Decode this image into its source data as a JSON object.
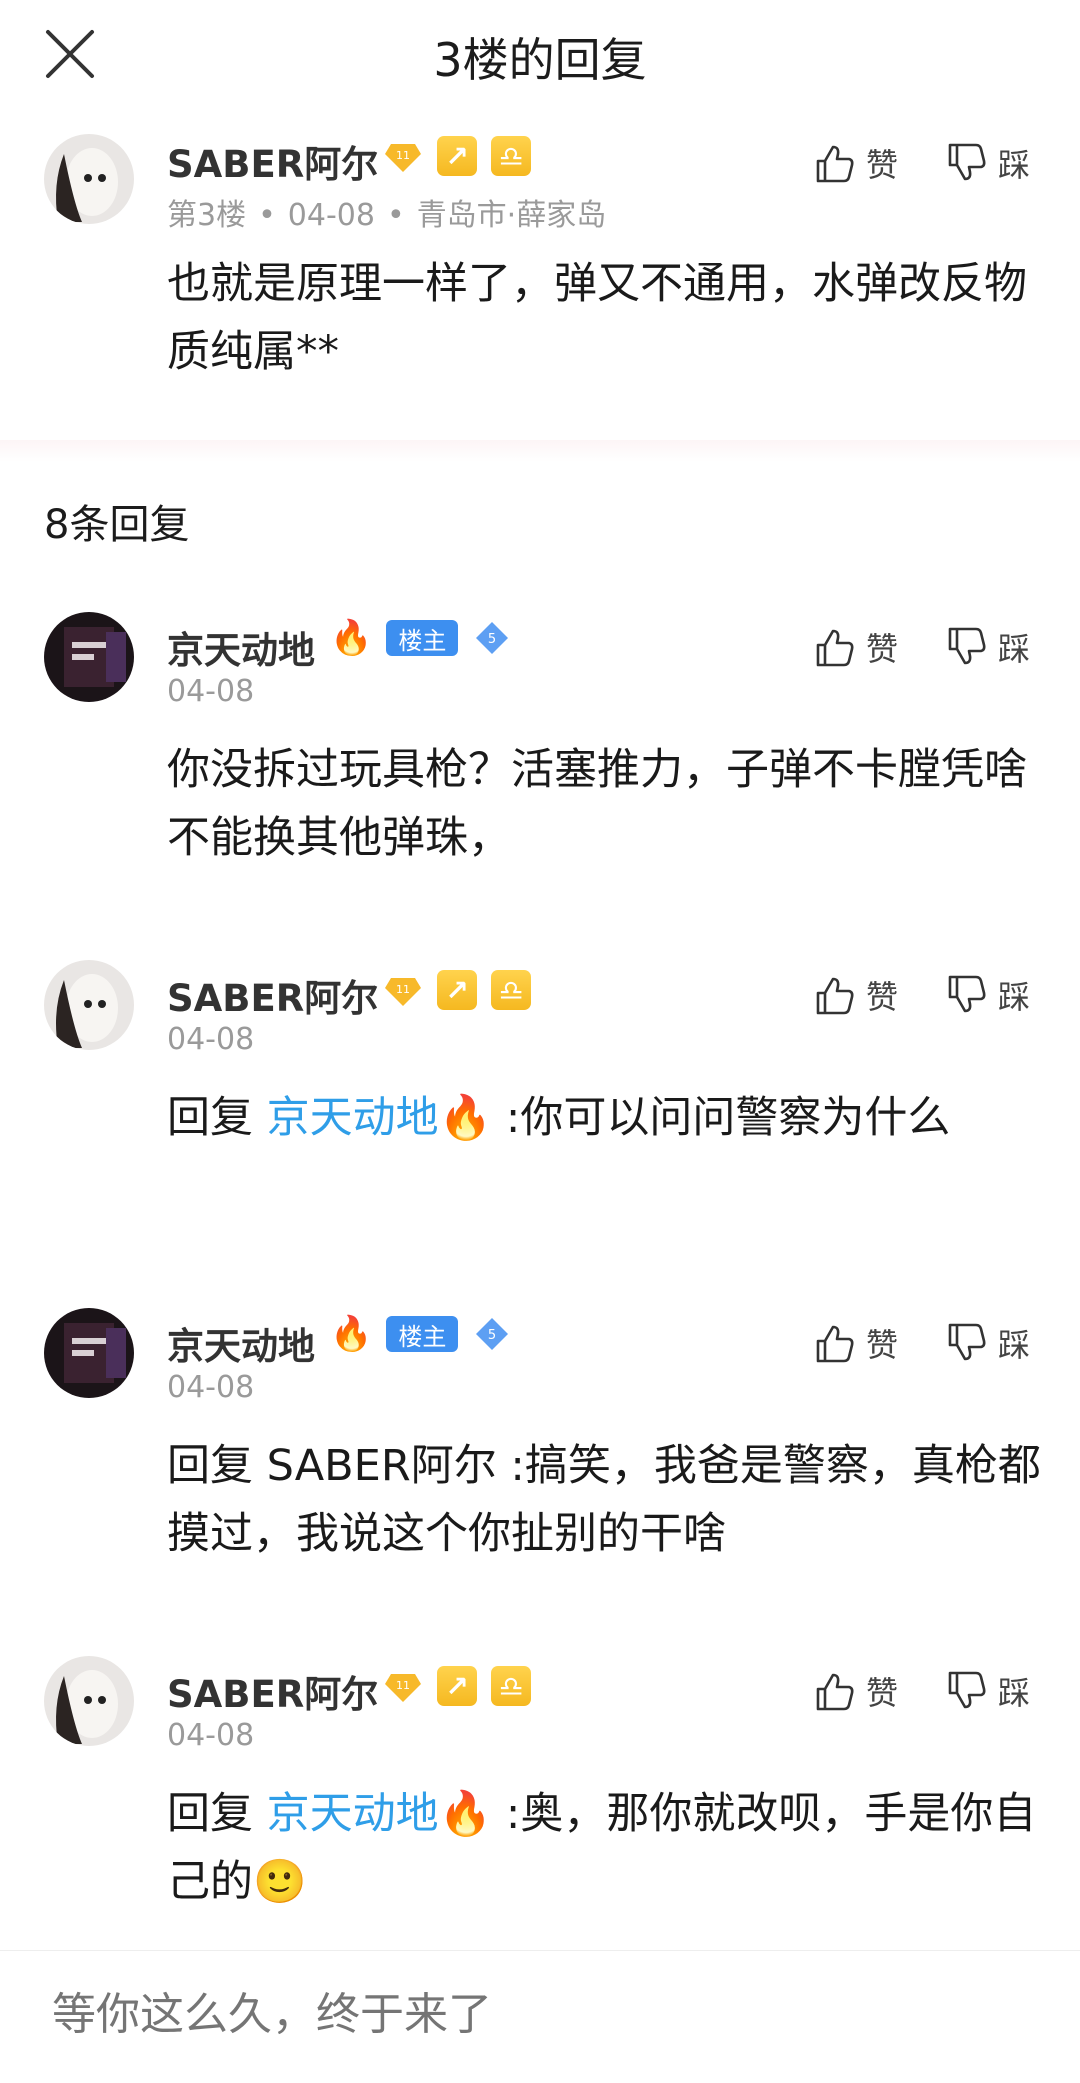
{
  "header": {
    "title": "3楼的回复",
    "close_label": "×"
  },
  "main_post": {
    "username": "SABER阿尔",
    "level": "11",
    "floor": "第3楼",
    "date": "04-08",
    "location": "青岛市·薛家岛",
    "content": "也就是原理一样了，弹又不通用，水弹改反物质纯属**",
    "like_label": "赞",
    "dislike_label": "踩"
  },
  "reply_count": "8条回复",
  "replies": [
    {
      "username": "京天动地",
      "owner_badge": "楼主",
      "level": "5",
      "date": "04-08",
      "reply_prefix": "",
      "mention": "",
      "content": "你没拆过玩具枪？活塞推力，子弹不卡膛凭啥不能换其他弹珠，",
      "like_label": "赞",
      "dislike_label": "踩"
    },
    {
      "username": "SABER阿尔",
      "level": "11",
      "date": "04-08",
      "reply_prefix": "回复 ",
      "mention": "京天动地",
      "content": " :你可以问问警察为什么",
      "like_label": "赞",
      "dislike_label": "踩"
    },
    {
      "username": "京天动地",
      "owner_badge": "楼主",
      "level": "5",
      "date": "04-08",
      "reply_prefix": "",
      "mention": "",
      "content": "回复 SABER阿尔 :搞笑，我爸是警察，真枪都摸过，我说这个你扯别的干啥",
      "like_label": "赞",
      "dislike_label": "踩"
    },
    {
      "username": "SABER阿尔",
      "level": "11",
      "date": "04-08",
      "reply_prefix": "回复 ",
      "mention": "京天动地",
      "content": " :奥，那你就改呗，手是你自己的",
      "like_label": "赞",
      "dislike_label": "踩"
    }
  ],
  "input": {
    "placeholder": "等你这么久，终于来了"
  },
  "colors": {
    "mention": "#2f9ee8",
    "owner_badge": "#3d8ff0",
    "meta": "#9a9a9a"
  },
  "icons": [
    "close-icon",
    "thumbs-up-icon",
    "thumbs-down-icon",
    "level-diamond-icon",
    "archer-sign-icon",
    "libra-sign-icon",
    "fire-icon",
    "smile-emoji"
  ]
}
